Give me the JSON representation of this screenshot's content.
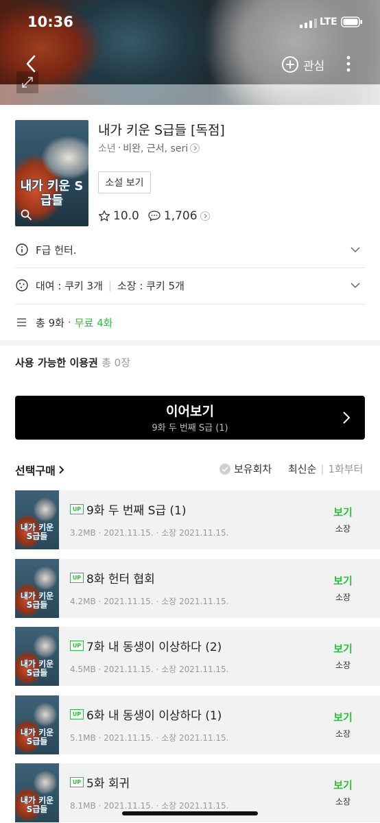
{
  "status_bar": {
    "time": "10:36",
    "network": "LTE"
  },
  "header": {
    "favorite_label": "관심"
  },
  "work": {
    "title": "내가 키운 S급들 [독점]",
    "genre": "소년",
    "authors": "비완, 근서, seri",
    "novel_button": "소설 보기",
    "rating": "10.0",
    "comments": "1,706",
    "cover_title": "내가 키운 S급들"
  },
  "info_rows": {
    "synopsis": "F급 헌터.",
    "rental": "대여 : 쿠키 3개",
    "purchase": "소장 : 쿠키 5개",
    "episodes_total": "총 9화",
    "episodes_free": "무료 4화"
  },
  "pass": {
    "label": "사용 가능한 이용권",
    "count": "총 0장"
  },
  "continue": {
    "label": "이어보기",
    "subtitle": "9화 두 번째 S급 (1)"
  },
  "list_controls": {
    "select_buy": "선택구매",
    "owned_filter": "보유회차",
    "sort_latest": "최신순",
    "sort_first": "1화부터"
  },
  "episodes": [
    {
      "badge": "UP",
      "title": "9화 두 번째 S급 (1)",
      "meta": "3.2MB · 2021.11.15. · 소장 2021.11.15.",
      "view": "보기",
      "owned": "소장"
    },
    {
      "badge": "UP",
      "title": "8화 헌터 협회",
      "meta": "4.2MB · 2021.11.15. · 소장 2021.11.15.",
      "view": "보기",
      "owned": "소장"
    },
    {
      "badge": "UP",
      "title": "7화 내 동생이 이상하다 (2)",
      "meta": "4.5MB · 2021.11.15. · 소장 2021.11.15.",
      "view": "보기",
      "owned": "소장"
    },
    {
      "badge": "UP",
      "title": "6화 내 동생이 이상하다 (1)",
      "meta": "5.1MB · 2021.11.15. · 소장 2021.11.15.",
      "view": "보기",
      "owned": "소장"
    },
    {
      "badge": "UP",
      "title": "5화 회귀",
      "meta": "8.1MB · 2021.11.15. · 소장 2021.11.15.",
      "view": "보기",
      "owned": "소장"
    }
  ],
  "colors": {
    "accent_green": "#2bc03a",
    "button_black": "#000000"
  }
}
